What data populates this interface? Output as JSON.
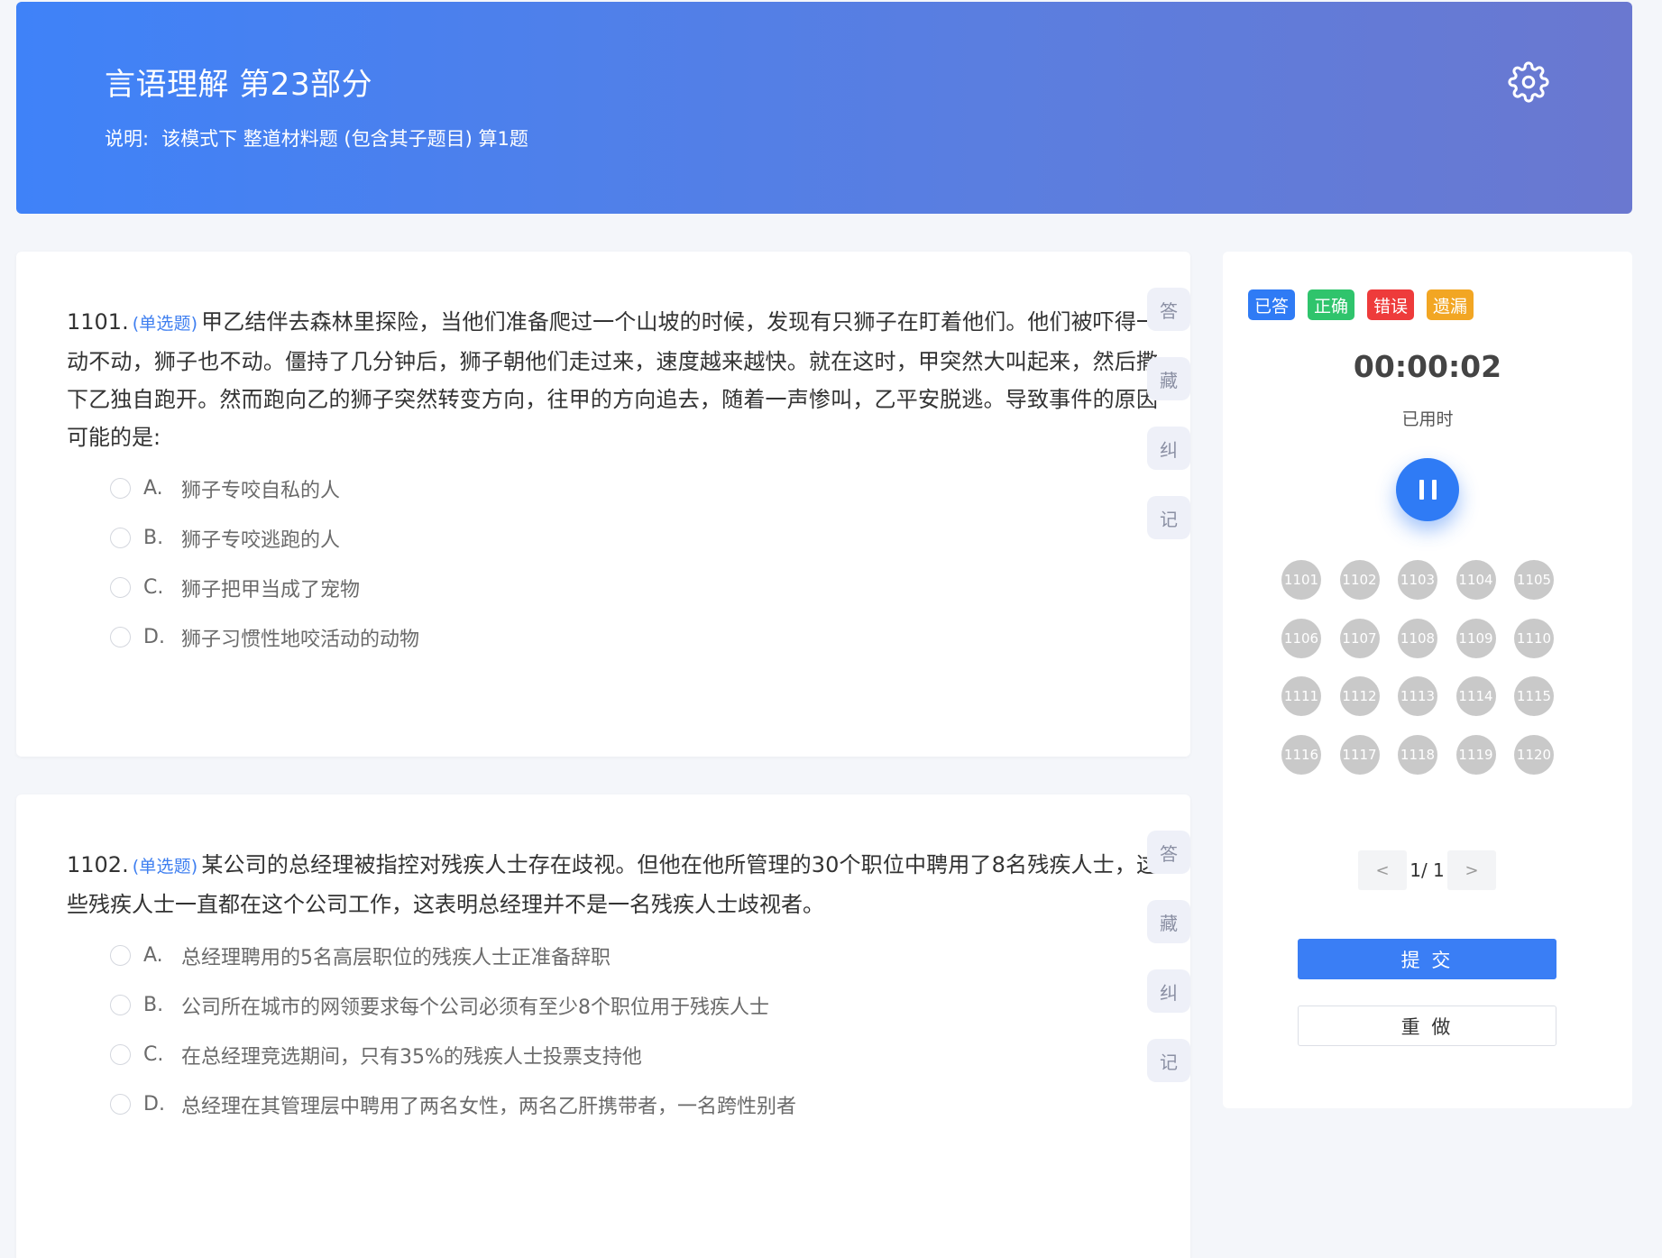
{
  "header": {
    "title": "言语理解 第23部分",
    "desc_label": "说明:",
    "desc_text": "该模式下 整道材料题 (包含其子题目) 算1题",
    "settings_icon": "gear-icon"
  },
  "questions": [
    {
      "number": "1101.",
      "type": "(单选题)",
      "text": "甲乙结伴去森林里探险，当他们准备爬过一个山坡的时候，发现有只狮子在盯着他们。他们被吓得一动不动，狮子也不动。僵持了几分钟后，狮子朝他们走过来，速度越来越快。就在这时，甲突然大叫起来，然后撒下乙独自跑开。然而跑向乙的狮子突然转变方向，往甲的方向追去，随着一声惨叫，乙平安脱逃。导致事件的原因可能的是:",
      "options": [
        {
          "letter": "A.",
          "text": "狮子专咬自私的人"
        },
        {
          "letter": "B.",
          "text": "狮子专咬逃跑的人"
        },
        {
          "letter": "C.",
          "text": "狮子把甲当成了宠物"
        },
        {
          "letter": "D.",
          "text": "狮子习惯性地咬活动的动物"
        }
      ]
    },
    {
      "number": "1102.",
      "type": "(单选题)",
      "text": "某公司的总经理被指控对残疾人士存在歧视。但他在他所管理的30个职位中聘用了8名残疾人士，这些残疾人士一直都在这个公司工作，这表明总经理并不是一名残疾人士歧视者。",
      "options": [
        {
          "letter": "A.",
          "text": "总经理聘用的5名高层职位的残疾人士正准备辞职"
        },
        {
          "letter": "B.",
          "text": "公司所在城市的网领要求每个公司必须有至少8个职位用于残疾人士"
        },
        {
          "letter": "C.",
          "text": "在总经理竞选期间，只有35%的残疾人士投票支持他"
        },
        {
          "letter": "D.",
          "text": "总经理在其管理层中聘用了两名女性，两名乙肝携带者，一名跨性别者"
        }
      ]
    }
  ],
  "side_actions": [
    "答",
    "藏",
    "纠",
    "记"
  ],
  "panel": {
    "legend": [
      {
        "label": "已答",
        "color": "#2f7bf5"
      },
      {
        "label": "正确",
        "color": "#2fc46c"
      },
      {
        "label": "错误",
        "color": "#ee3b3b"
      },
      {
        "label": "遗漏",
        "color": "#f2a623"
      }
    ],
    "timer": "00:00:02",
    "timer_label": "已用时",
    "pause_icon": "pause-icon",
    "numbers": [
      "1101",
      "1102",
      "1103",
      "1104",
      "1105",
      "1106",
      "1107",
      "1108",
      "1109",
      "1110",
      "1111",
      "1112",
      "1113",
      "1114",
      "1115",
      "1116",
      "1117",
      "1118",
      "1119",
      "1120"
    ],
    "pager": {
      "prev": "<",
      "text": "1/ 1",
      "next": ">"
    },
    "submit": "提 交",
    "redo": "重 做"
  }
}
